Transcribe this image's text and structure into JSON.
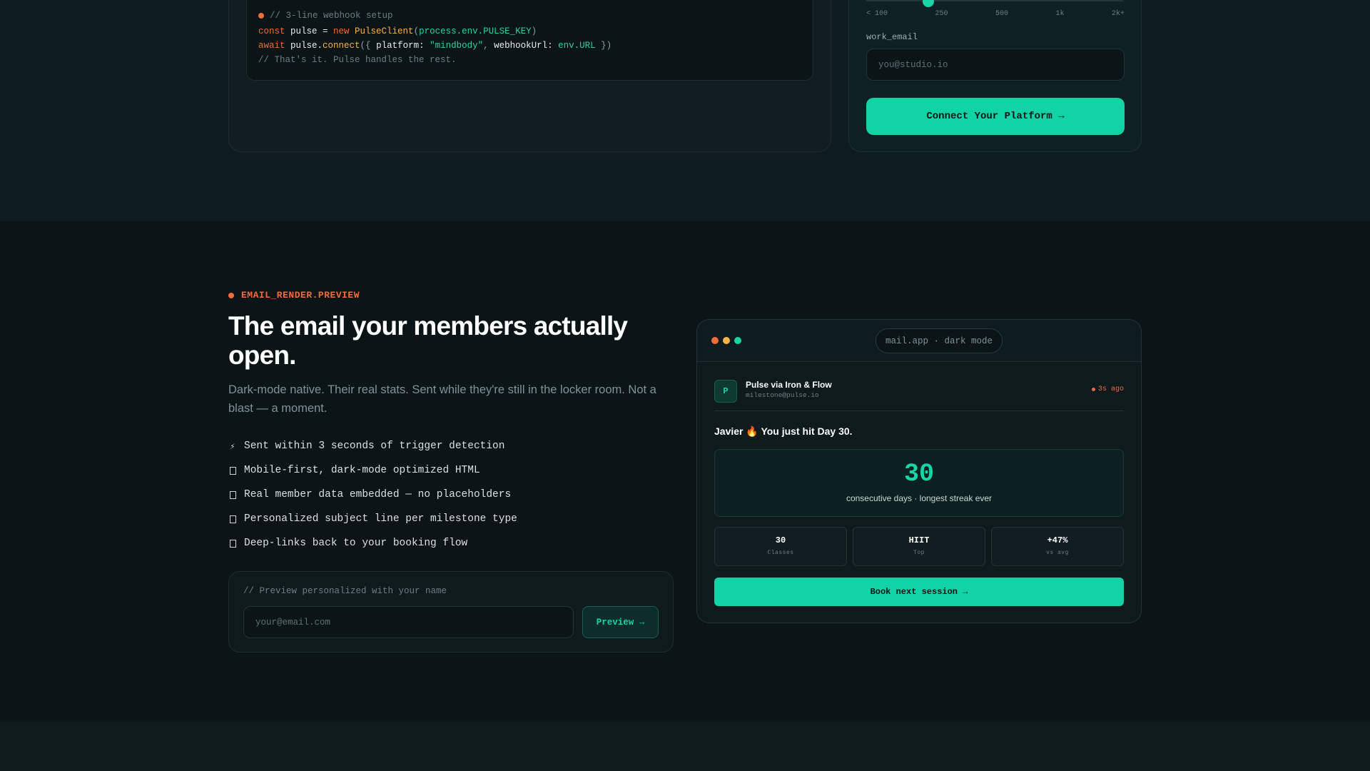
{
  "setup_card": {
    "code_title": "// 3-line webhook setup",
    "line1": {
      "kw": "const",
      "var": " pulse = ",
      "kw2": "new",
      "cls": " PulseClient",
      "open": "(",
      "arg": "process.env.PULSE_KEY",
      "close": ")"
    },
    "line2": {
      "kw": "await",
      "obj": " pulse.",
      "fn": "connect",
      "open": "({ ",
      "key1": "platform: ",
      "val1": "\"mindbody\"",
      "sep": ", ",
      "key2": "webhookUrl: ",
      "val2": "env.URL",
      "close": " })"
    },
    "comment": "// That's it. Pulse handles the rest."
  },
  "signup_card": {
    "slider_ticks": [
      "< 100",
      "250",
      "500",
      "1k",
      "2k+"
    ],
    "slider_value_fraction": 0.22,
    "email_label": "work_email",
    "email_placeholder": "you@studio.io",
    "cta_label": "Connect Your Platform →"
  },
  "email_section": {
    "eyebrow": "EMAIL_RENDER.PREVIEW",
    "headline": "The email your members actually open.",
    "subcopy": "Dark-mode native. Their real stats. Sent while they're still in the locker room. Not a blast — a moment.",
    "features": [
      {
        "icon": "lightning-icon",
        "glyph": "⚡",
        "text": "Sent within 3 seconds of trigger detection"
      },
      {
        "icon": "box-icon",
        "glyph": "",
        "text": "Mobile-first, dark-mode optimized HTML"
      },
      {
        "icon": "box-icon",
        "glyph": "",
        "text": "Real member data embedded — no placeholders"
      },
      {
        "icon": "box-icon",
        "glyph": "",
        "text": "Personalized subject line per milestone type"
      },
      {
        "icon": "box-icon",
        "glyph": "",
        "text": "Deep-links back to your booking flow"
      }
    ],
    "preview": {
      "note": "// Preview personalized with your name",
      "placeholder": "your@email.com",
      "button": "Preview →"
    }
  },
  "mail_preview": {
    "window_title": "mail.app · dark mode",
    "traffic_colors": [
      "#f26b3a",
      "#f5b547",
      "#18d4a6"
    ],
    "sender": {
      "avatar": "P",
      "name": "Pulse via Iron & Flow",
      "address": "milestone@pulse.io",
      "time": "3s ago"
    },
    "subject": "Javier 🔥 You just hit Day 30.",
    "streak": {
      "number": "30",
      "caption": "consecutive days · longest streak ever"
    },
    "stats": [
      {
        "value": "30",
        "label": "Classes"
      },
      {
        "value": "HIIT",
        "label": "Top"
      },
      {
        "value": "+47%",
        "label": "vs avg"
      }
    ],
    "button": "Book next session →"
  },
  "colors": {
    "accent": "#18d4a6",
    "orange": "#f26b3a",
    "background": "#0b1416"
  }
}
